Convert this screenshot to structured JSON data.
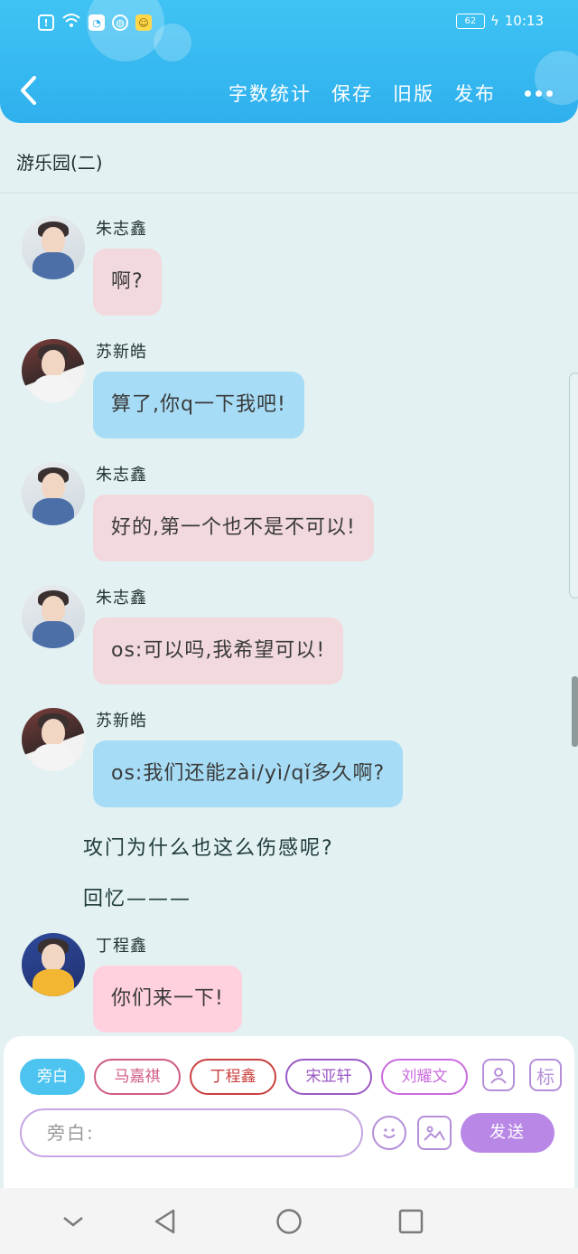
{
  "status_bar": {
    "time": "10:13",
    "battery": "62"
  },
  "header": {
    "actions": [
      "字数统计",
      "保存",
      "旧版",
      "发布"
    ]
  },
  "chapter": {
    "title": "游乐园(二)"
  },
  "messages": [
    {
      "sender": "朱志鑫",
      "text": "啊?",
      "bubble": "pink"
    },
    {
      "sender": "苏新皓",
      "text": "算了,你q一下我吧!",
      "bubble": "blue"
    },
    {
      "sender": "朱志鑫",
      "text": "好的,第一个也不是不可以!",
      "bubble": "pink"
    },
    {
      "sender": "朱志鑫",
      "text": "os:可以吗,我希望可以!",
      "bubble": "pink"
    },
    {
      "sender": "苏新皓",
      "text": "os:我们还能zài/yì/qǐ多久啊?",
      "bubble": "blue"
    },
    {
      "sender": "丁程鑫",
      "text": "你们来一下!",
      "bubble": "rose"
    }
  ],
  "narration": [
    "攻门为什么也这么伤感呢?",
    "回忆———"
  ],
  "composer": {
    "roles": [
      "旁白",
      "马嘉祺",
      "丁程鑫",
      "宋亚轩",
      "刘耀文"
    ],
    "tag_button": "标",
    "input_placeholder": "旁白:",
    "send_label": "发送"
  },
  "colors": {
    "header": "#2fb0ee",
    "background": "#e3f1f2",
    "bubble_pink": "#f2d9de",
    "bubble_blue": "#a6dcf5",
    "send": "#b988e6"
  }
}
